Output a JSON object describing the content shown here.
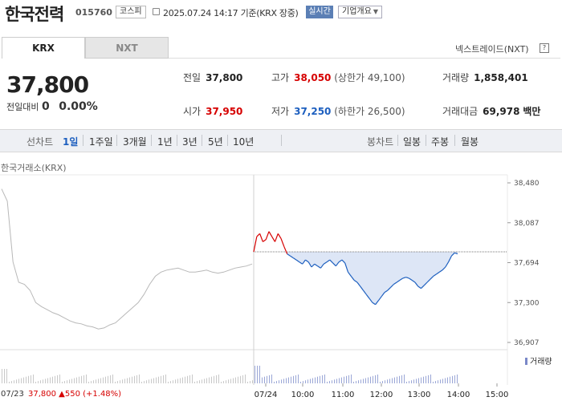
{
  "header": {
    "name": "한국전력",
    "code": "015760",
    "market": "코스피",
    "datetime": "2025.07.24 14:17 기준(KRX 장중)",
    "realtime": "실시간",
    "company_info": "기업개요"
  },
  "tabs": [
    "KRX",
    "NXT"
  ],
  "nextrade": "넥스트레이드(NXT)",
  "help": "?",
  "price": "37,800",
  "change": {
    "label": "전일대비",
    "value": "0",
    "pct": "0.00%"
  },
  "stats": {
    "prev": {
      "label": "전일",
      "value": "37,800"
    },
    "high": {
      "label": "고가",
      "value": "38,050",
      "sub": "(상한가 49,100)"
    },
    "volume": {
      "label": "거래량",
      "value": "1,858,401"
    },
    "open": {
      "label": "시가",
      "value": "37,950"
    },
    "low": {
      "label": "저가",
      "value": "37,250",
      "sub": "(하한가 26,500)"
    },
    "amount": {
      "label": "거래대금",
      "value": "69,978",
      "unit": "백만"
    }
  },
  "toolbar": {
    "line_label": "선차트",
    "periods": [
      "1일",
      "1주일",
      "3개월",
      "1년",
      "3년",
      "5년",
      "10년"
    ],
    "selected": "1일",
    "candle_label": "봉차트",
    "candle_periods": [
      "일봉",
      "주봉",
      "월봉"
    ]
  },
  "chart_title": "한국거래소(KRX)",
  "volume_legend": "거래량",
  "footer": {
    "prev_date": "07/23",
    "prev_price": "37,800 ▲550 (+1.48%)"
  },
  "colors": {
    "up": "#d60000",
    "down": "#1d5fbf",
    "prev_day": "#b8b8b8",
    "fill": "#dde6f6"
  },
  "chart_data": {
    "type": "line",
    "y_ticks": [
      "38,480",
      "38,087",
      "37,694",
      "37,300",
      "36,907"
    ],
    "ylim": [
      36907,
      38480
    ],
    "prev_close": 37800,
    "x_ticks": [
      "07/23",
      "07/24",
      "10:00",
      "11:00",
      "12:00",
      "13:00",
      "14:00",
      "15:00"
    ],
    "prev_day_series": [
      38420,
      38300,
      37700,
      37500,
      37480,
      37420,
      37300,
      37260,
      37230,
      37200,
      37180,
      37150,
      37120,
      37100,
      37090,
      37070,
      37060,
      37040,
      37050,
      37080,
      37100,
      37150,
      37200,
      37250,
      37300,
      37380,
      37480,
      37560,
      37600,
      37620,
      37630,
      37640,
      37620,
      37600,
      37600,
      37610,
      37620,
      37600,
      37590,
      37600,
      37620,
      37640,
      37650,
      37660,
      37680
    ],
    "today_series": [
      37800,
      37950,
      37980,
      37900,
      37920,
      38000,
      37950,
      37900,
      37980,
      37930,
      37850,
      37780,
      37760,
      37740,
      37720,
      37700,
      37680,
      37720,
      37700,
      37650,
      37680,
      37660,
      37640,
      37680,
      37700,
      37720,
      37690,
      37660,
      37700,
      37720,
      37690,
      37600,
      37560,
      37520,
      37500,
      37460,
      37420,
      37380,
      37340,
      37300,
      37280,
      37320,
      37360,
      37400,
      37420,
      37450,
      37480,
      37500,
      37520,
      37540,
      37550,
      37540,
      37520,
      37500,
      37460,
      37440,
      37470,
      37500,
      37530,
      37560,
      37580,
      37600,
      37620,
      37650,
      37700,
      37760,
      37790,
      37780
    ]
  }
}
